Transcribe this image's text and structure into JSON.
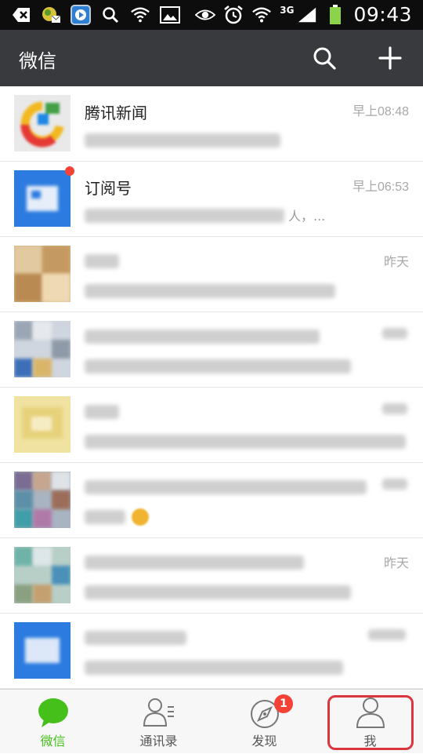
{
  "status_bar": {
    "network": "3G",
    "time": "09:43"
  },
  "header": {
    "title": "微信"
  },
  "chats": [
    {
      "name": "腾讯新闻",
      "time": "早上08:48",
      "preview": ""
    },
    {
      "name": "订阅号",
      "time": "早上06:53",
      "preview": "人，..."
    },
    {
      "name": "",
      "time": "昨天",
      "preview": ""
    },
    {
      "name": "",
      "time": "",
      "preview": ""
    },
    {
      "name": "",
      "time": "",
      "preview": ""
    },
    {
      "name": "",
      "time": "",
      "preview": ""
    },
    {
      "name": "",
      "time": "昨天",
      "preview": ""
    },
    {
      "name": "",
      "time": "",
      "preview": ""
    }
  ],
  "tabs": [
    {
      "label": "微信",
      "active": true
    },
    {
      "label": "通讯录",
      "active": false
    },
    {
      "label": "发现",
      "active": false,
      "badge": "1"
    },
    {
      "label": "我",
      "active": false
    }
  ],
  "colors": {
    "header_bg": "#393a3e",
    "accent_green": "#45c01a",
    "badge_red": "#f44336",
    "highlight_red": "#d9363e"
  }
}
